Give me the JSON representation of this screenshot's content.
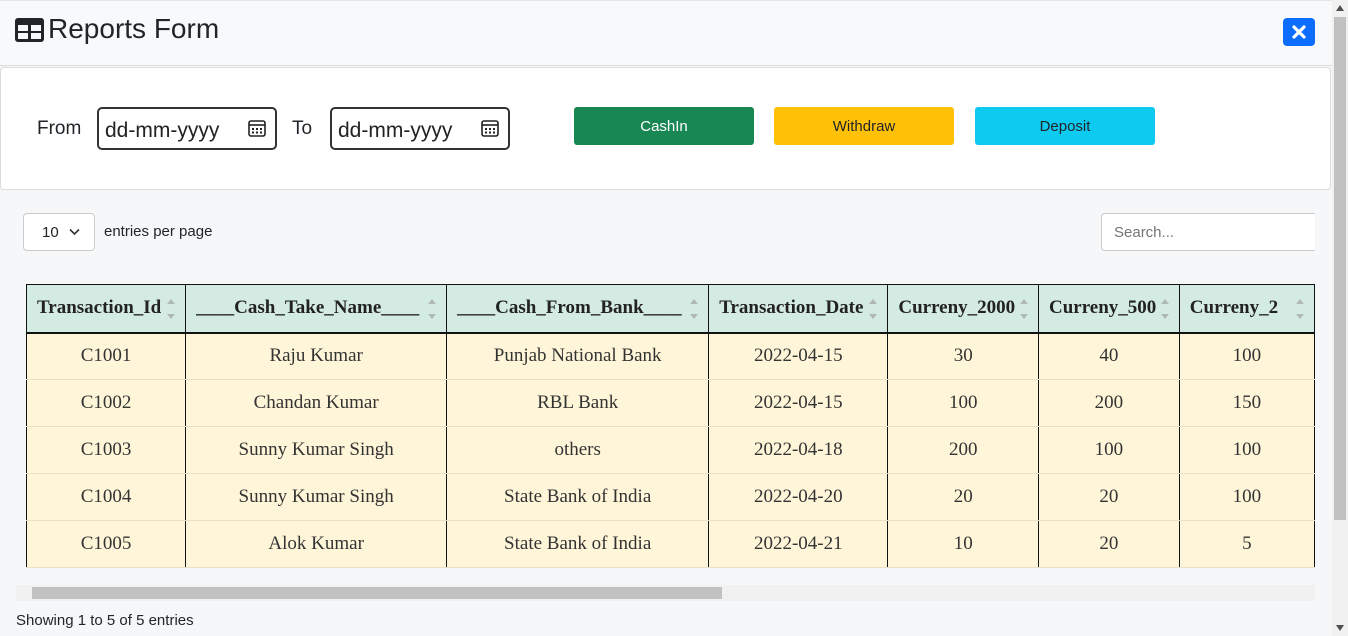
{
  "header": {
    "title": "Reports Form"
  },
  "filters": {
    "from_label": "From",
    "to_label": "To",
    "from_placeholder": "dd-mm-yyyy",
    "to_placeholder": "dd-mm-yyyy",
    "cashin_label": "CashIn",
    "withdraw_label": "Withdraw",
    "deposit_label": "Deposit"
  },
  "datatable": {
    "per_page_value": "10",
    "per_page_label": "entries per page",
    "search_placeholder": "Search...",
    "columns": [
      "Transaction_Id",
      "____Cash_Take_Name____",
      "____Cash_From_Bank____",
      "Transaction_Date",
      "Curreny_2000",
      "Curreny_500",
      "Curreny_2"
    ],
    "rows": [
      [
        "C1001",
        "Raju Kumar",
        "Punjab National Bank",
        "2022-04-15",
        "30",
        "40",
        "100"
      ],
      [
        "C1002",
        "Chandan Kumar",
        "RBL Bank",
        "2022-04-15",
        "100",
        "200",
        "150"
      ],
      [
        "C1003",
        "Sunny Kumar Singh",
        "others",
        "2022-04-18",
        "200",
        "100",
        "100"
      ],
      [
        "C1004",
        "Sunny Kumar Singh",
        "State Bank of India",
        "2022-04-20",
        "20",
        "20",
        "100"
      ],
      [
        "C1005",
        "Alok Kumar",
        "State Bank of India",
        "2022-04-21",
        "10",
        "20",
        "5"
      ]
    ],
    "info": "Showing 1 to 5 of 5 entries"
  },
  "colors": {
    "primary": "#0d6efd",
    "success": "#198754",
    "warning": "#ffc107",
    "info": "#0dcaf0",
    "header_bg": "#d4ebe4",
    "row_bg": "#fff6d9"
  }
}
